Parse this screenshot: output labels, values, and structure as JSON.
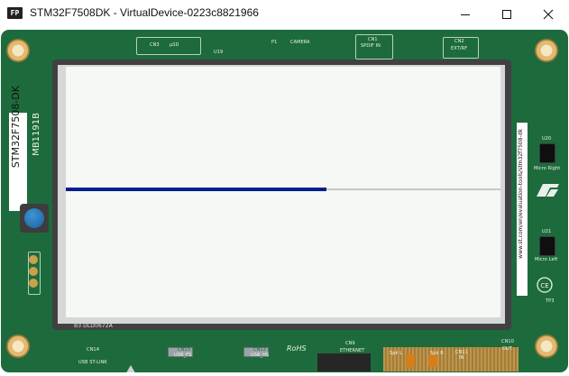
{
  "window": {
    "title": "STM32F7508DK - VirtualDevice-0223c8821966",
    "icon_text": "FP",
    "controls": {
      "minimize_icon": "minimize-icon",
      "maximize_icon": "maximize-icon",
      "close_icon": "close-icon"
    }
  },
  "board": {
    "model": "STM32F7508-DK",
    "part_number": "MB1191B",
    "url": "www.st.com/en/evaluation-tools/stm32f7508-dk",
    "lcd_code": "B3 DLD0672A",
    "silkscreen": {
      "cn3": "CN3",
      "usd": "µSD",
      "u19": "U19",
      "p1": "P1",
      "camera": "CAMERA",
      "cn1": "CN1",
      "spdif_in": "SPDIF IN",
      "cn2": "CN2",
      "ext_rf": "EXT/RF",
      "u20": "U20",
      "micro_right": "Micro Right",
      "u21": "U21",
      "micro_left": "Micro Left",
      "tp3": "TP3",
      "cn14": "CN14",
      "usb_stlink": "USB ST-LINK",
      "cn13": "CN13",
      "usb_fs": "USB_FS",
      "cn12": "CN12",
      "usb_hs": "USB_HS",
      "rohs": "RoHS",
      "cn9": "CN9",
      "ethernet": "ETHERNET",
      "cn10": "CN10",
      "out": "OUT",
      "cn11": "CN11",
      "in": "IN",
      "spk_l": "Spk L",
      "spk_r": "Spk R",
      "cn8": "CN8",
      "cn7": "CN7"
    },
    "display": {
      "background_color": "#f5f8f5",
      "progress_fraction": 0.6,
      "fill_color": "#001e8c",
      "track_color": "#c7c7c7"
    },
    "user_button_icon": "blue-push-button-icon"
  }
}
